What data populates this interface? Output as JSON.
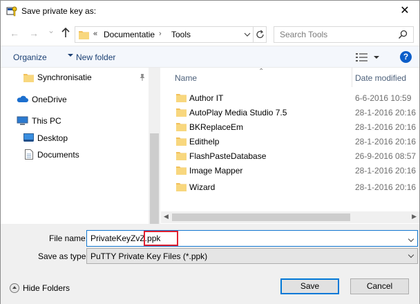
{
  "window": {
    "title": "Save private key as:",
    "close_glyph": "✕"
  },
  "nav": {
    "back_glyph": "←",
    "forward_glyph": "→",
    "recent_glyph": "⌄",
    "up_glyph": "↑",
    "address": {
      "overflow": "«",
      "segment1": "Documentatie",
      "separator": "›",
      "segment2": "Tools"
    },
    "search_placeholder": "Search Tools"
  },
  "toolbar": {
    "organize": "Organize",
    "new_folder": "New folder",
    "help": "?"
  },
  "sidebar": {
    "items": [
      {
        "label": "Synchronisatie",
        "icon": "folder-icon",
        "pinned": true
      },
      {
        "label": "OneDrive",
        "icon": "cloud-icon"
      },
      {
        "label": "This PC",
        "icon": "computer-icon"
      },
      {
        "label": "Desktop",
        "icon": "desktop-icon"
      },
      {
        "label": "Documents",
        "icon": "documents-icon"
      }
    ],
    "pin_glyph": "📌"
  },
  "files": {
    "columns": {
      "name": "Name",
      "date": "Date modified",
      "sort_glyph": "⌃"
    },
    "rows": [
      {
        "name": "Author IT",
        "date": "6-6-2016 10:59"
      },
      {
        "name": "AutoPlay Media Studio 7.5",
        "date": "28-1-2016 20:16"
      },
      {
        "name": "BKReplaceEm",
        "date": "28-1-2016 20:16"
      },
      {
        "name": "Edithelp",
        "date": "28-1-2016 20:16"
      },
      {
        "name": "FlashPasteDatabase",
        "date": "26-9-2016 08:57"
      },
      {
        "name": "Image Mapper",
        "date": "28-1-2016 20:16"
      },
      {
        "name": "Wizard",
        "date": "28-1-2016 20:16"
      }
    ]
  },
  "form": {
    "file_name_label": "File name:",
    "file_name_value": "PrivateKeyZvZ.ppk",
    "save_type_label": "Save as type:",
    "save_type_value": "PuTTY Private Key Files (*.ppk)"
  },
  "footer": {
    "hide_folders": "Hide Folders",
    "save": "Save",
    "cancel": "Cancel"
  },
  "colors": {
    "accent": "#0078d7",
    "highlight_box": "#e0202f",
    "folder": "#f2c05a"
  }
}
